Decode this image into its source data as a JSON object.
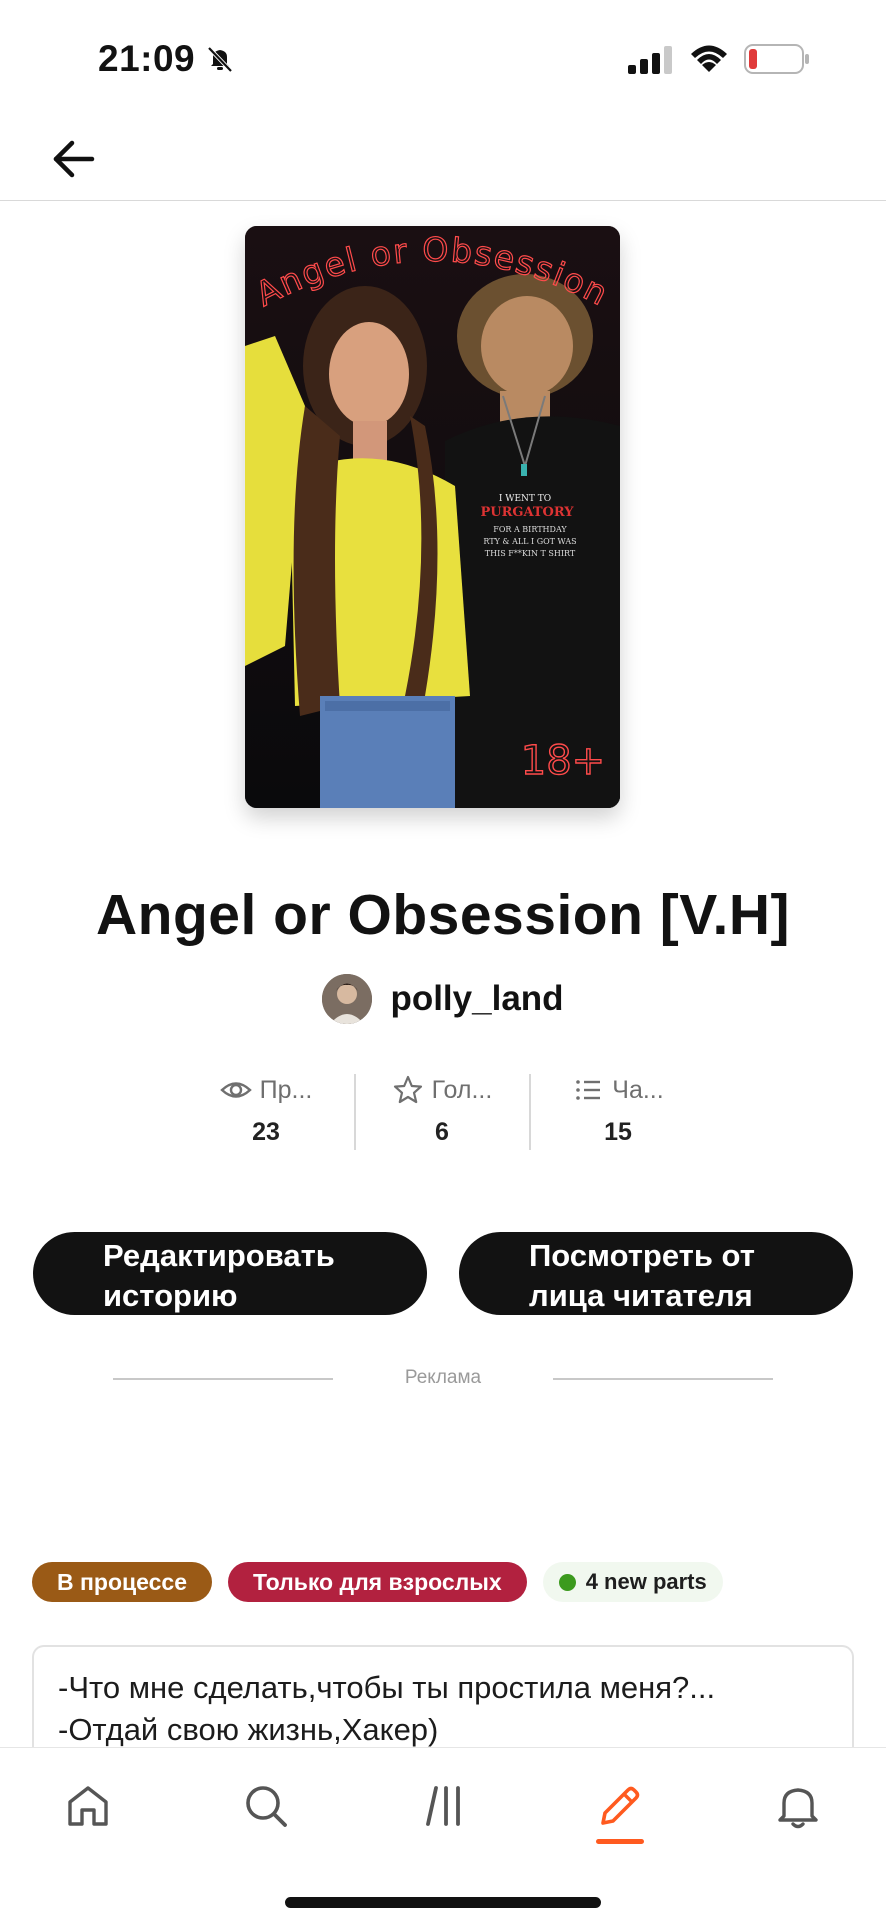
{
  "status_bar": {
    "time": "21:09",
    "icons": [
      "bell-slash-icon",
      "cellular-signal-icon",
      "wifi-icon",
      "battery-low-icon"
    ],
    "battery_color": "#e03a3a"
  },
  "header": {
    "back_icon": "arrow-left-icon"
  },
  "story": {
    "cover_title_text": "Angel or Obsession",
    "cover_badge_text": "18+",
    "cover_shirt_text": "I WENT TO PURGATORY FOR A BIRTHDAY PARTY & ALL I GOT WAS THIS F**KIN T SHIRT",
    "title": "Angel or Obsession [V.H]",
    "author": "polly_land"
  },
  "stats": [
    {
      "icon": "eye-icon",
      "label": "Пр...",
      "value": "23"
    },
    {
      "icon": "star-icon",
      "label": "Гол...",
      "value": "6"
    },
    {
      "icon": "list-icon",
      "label": "Ча...",
      "value": "15"
    }
  ],
  "actions": {
    "edit_line1": "Редактировать",
    "edit_line2": "историю",
    "view_line1": "Посмотреть от",
    "view_line2": "лица читателя"
  },
  "ad_label": "Реклама",
  "tags": {
    "status": "В процессе",
    "mature": "Только для взрослых",
    "new_parts": "4 new parts"
  },
  "description": {
    "line1": "-Что мне сделать,чтобы ты простила меня?...",
    "line2": "-Отдай свою жизнь,Хакер)"
  },
  "bottom_nav": {
    "items": [
      "home-icon",
      "search-icon",
      "library-icon",
      "write-icon",
      "notifications-icon"
    ],
    "active": "write-icon",
    "accent_color": "#ff5a1f"
  }
}
